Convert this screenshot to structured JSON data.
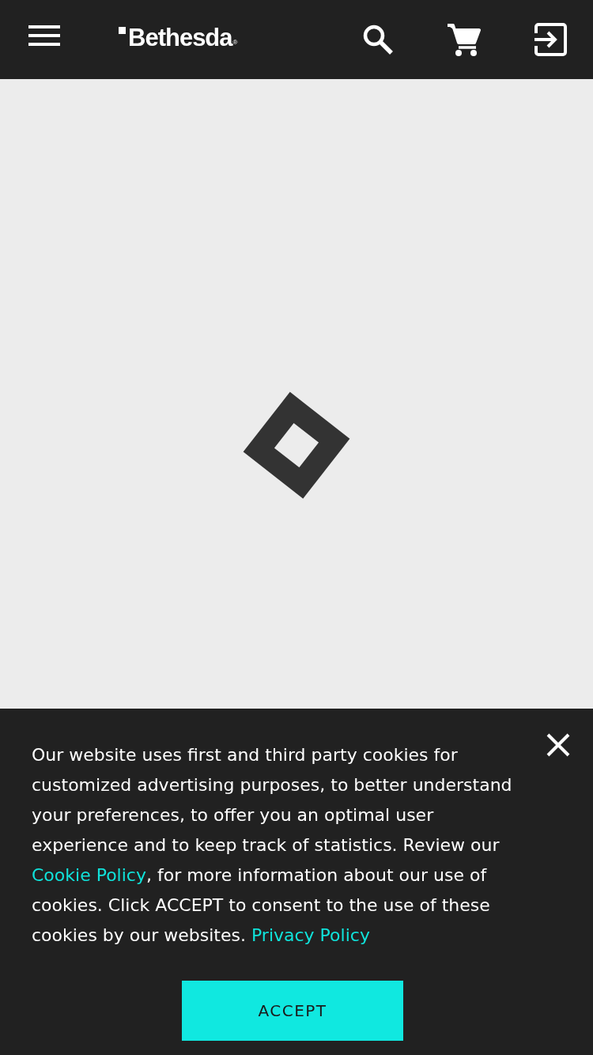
{
  "header": {
    "logo": {
      "text": "Bethesda",
      "mark": "®"
    }
  },
  "cookie_banner": {
    "segments": [
      {
        "kind": "text",
        "text": "Our website uses first and third party cookies for customized advertising purposes, to better understand your preferences, to offer you an optimal user experience and to keep track of statistics. Review our "
      },
      {
        "kind": "link",
        "text": "Cookie Policy"
      },
      {
        "kind": "text",
        "text": ", for more information about our use of cookies. Click ACCEPT to consent to the use of these cookies by our websites. "
      },
      {
        "kind": "link",
        "text": "Privacy Policy"
      }
    ],
    "accept_button": "ACCEPT"
  }
}
